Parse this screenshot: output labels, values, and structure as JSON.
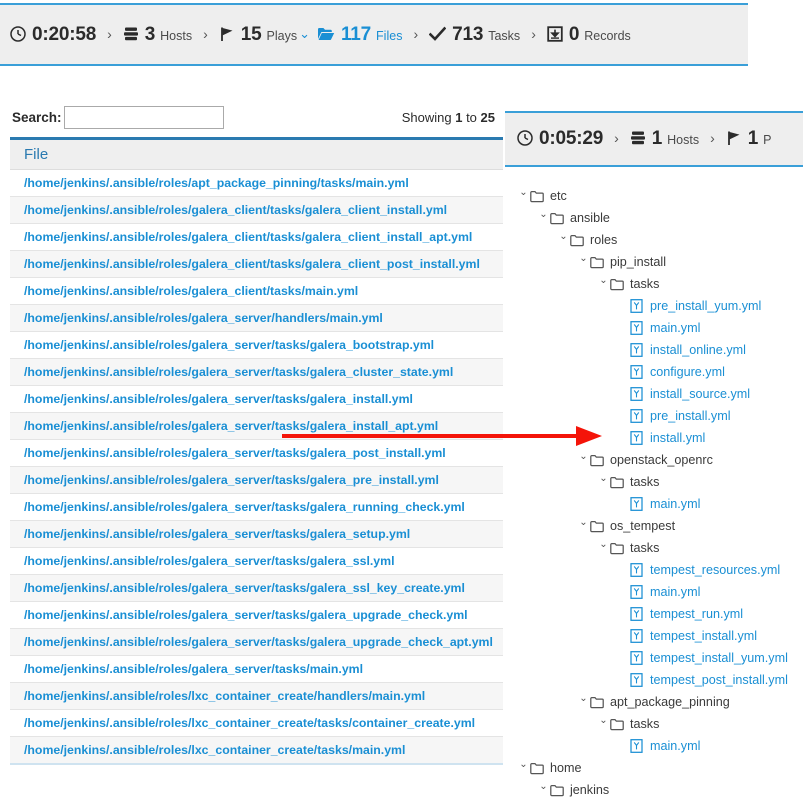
{
  "header": {
    "stats": [
      {
        "icon": "clock-icon",
        "value": "0:20:58",
        "label": "",
        "active": false,
        "type": "time"
      },
      {
        "icon": "server-stack-icon",
        "value": "3",
        "label": "Hosts",
        "active": false,
        "type": "stat"
      },
      {
        "icon": "flag-icon",
        "value": "15",
        "label": "Plays",
        "active": false,
        "type": "stat"
      },
      {
        "icon": "folder-open-icon",
        "value": "117",
        "label": "Files",
        "active": true,
        "type": "stat"
      },
      {
        "icon": "check-icon",
        "value": "713",
        "label": "Tasks",
        "active": false,
        "type": "stat"
      },
      {
        "icon": "download-box-icon",
        "value": "0",
        "label": "Records",
        "active": false,
        "type": "stat"
      }
    ],
    "separator": "›",
    "chevron_down": "⌄"
  },
  "subheader": {
    "stats": [
      {
        "icon": "clock-icon",
        "value": "0:05:29",
        "label": "",
        "active": false,
        "type": "time"
      },
      {
        "icon": "server-stack-icon",
        "value": "1",
        "label": "Hosts",
        "active": false,
        "type": "stat"
      },
      {
        "icon": "flag-icon",
        "value": "1",
        "label": "P",
        "active": false,
        "type": "stat"
      }
    ]
  },
  "files_panel": {
    "search_label": "Search:",
    "search_value": "",
    "search_placeholder": "",
    "showing_prefix": "Showing",
    "showing_from": "1",
    "showing_mid": "to",
    "showing_to": "25",
    "column_header": "File",
    "rows": [
      "/home/jenkins/.ansible/roles/apt_package_pinning/tasks/main.yml",
      "/home/jenkins/.ansible/roles/galera_client/tasks/galera_client_install.yml",
      "/home/jenkins/.ansible/roles/galera_client/tasks/galera_client_install_apt.yml",
      "/home/jenkins/.ansible/roles/galera_client/tasks/galera_client_post_install.yml",
      "/home/jenkins/.ansible/roles/galera_client/tasks/main.yml",
      "/home/jenkins/.ansible/roles/galera_server/handlers/main.yml",
      "/home/jenkins/.ansible/roles/galera_server/tasks/galera_bootstrap.yml",
      "/home/jenkins/.ansible/roles/galera_server/tasks/galera_cluster_state.yml",
      "/home/jenkins/.ansible/roles/galera_server/tasks/galera_install.yml",
      "/home/jenkins/.ansible/roles/galera_server/tasks/galera_install_apt.yml",
      "/home/jenkins/.ansible/roles/galera_server/tasks/galera_post_install.yml",
      "/home/jenkins/.ansible/roles/galera_server/tasks/galera_pre_install.yml",
      "/home/jenkins/.ansible/roles/galera_server/tasks/galera_running_check.yml",
      "/home/jenkins/.ansible/roles/galera_server/tasks/galera_setup.yml",
      "/home/jenkins/.ansible/roles/galera_server/tasks/galera_ssl.yml",
      "/home/jenkins/.ansible/roles/galera_server/tasks/galera_ssl_key_create.yml",
      "/home/jenkins/.ansible/roles/galera_server/tasks/galera_upgrade_check.yml",
      "/home/jenkins/.ansible/roles/galera_server/tasks/galera_upgrade_check_apt.yml",
      "/home/jenkins/.ansible/roles/galera_server/tasks/main.yml",
      "/home/jenkins/.ansible/roles/lxc_container_create/handlers/main.yml",
      "/home/jenkins/.ansible/roles/lxc_container_create/tasks/container_create.yml",
      "/home/jenkins/.ansible/roles/lxc_container_create/tasks/main.yml"
    ]
  },
  "tree_panel": {
    "nodes": [
      {
        "label": "etc",
        "depth": 0,
        "kind": "dir"
      },
      {
        "label": "ansible",
        "depth": 1,
        "kind": "dir"
      },
      {
        "label": "roles",
        "depth": 2,
        "kind": "dir"
      },
      {
        "label": "pip_install",
        "depth": 3,
        "kind": "dir"
      },
      {
        "label": "tasks",
        "depth": 4,
        "kind": "dir"
      },
      {
        "label": "pre_install_yum.yml",
        "depth": 5,
        "kind": "file"
      },
      {
        "label": "main.yml",
        "depth": 5,
        "kind": "file"
      },
      {
        "label": "install_online.yml",
        "depth": 5,
        "kind": "file"
      },
      {
        "label": "configure.yml",
        "depth": 5,
        "kind": "file"
      },
      {
        "label": "install_source.yml",
        "depth": 5,
        "kind": "file"
      },
      {
        "label": "pre_install.yml",
        "depth": 5,
        "kind": "file"
      },
      {
        "label": "install.yml",
        "depth": 5,
        "kind": "file"
      },
      {
        "label": "openstack_openrc",
        "depth": 3,
        "kind": "dir"
      },
      {
        "label": "tasks",
        "depth": 4,
        "kind": "dir"
      },
      {
        "label": "main.yml",
        "depth": 5,
        "kind": "file"
      },
      {
        "label": "os_tempest",
        "depth": 3,
        "kind": "dir"
      },
      {
        "label": "tasks",
        "depth": 4,
        "kind": "dir"
      },
      {
        "label": "tempest_resources.yml",
        "depth": 5,
        "kind": "file"
      },
      {
        "label": "main.yml",
        "depth": 5,
        "kind": "file"
      },
      {
        "label": "tempest_run.yml",
        "depth": 5,
        "kind": "file"
      },
      {
        "label": "tempest_install.yml",
        "depth": 5,
        "kind": "file"
      },
      {
        "label": "tempest_install_yum.yml",
        "depth": 5,
        "kind": "file"
      },
      {
        "label": "tempest_post_install.yml",
        "depth": 5,
        "kind": "file"
      },
      {
        "label": "apt_package_pinning",
        "depth": 3,
        "kind": "dir"
      },
      {
        "label": "tasks",
        "depth": 4,
        "kind": "dir"
      },
      {
        "label": "main.yml",
        "depth": 5,
        "kind": "file"
      },
      {
        "label": "home",
        "depth": 0,
        "kind": "dir"
      },
      {
        "label": "jenkins",
        "depth": 1,
        "kind": "dir"
      }
    ]
  },
  "annotation": {
    "arrow_color": "#f41409",
    "underline_color": "#f41409"
  },
  "colors": {
    "accent_blue": "#1a8fd4",
    "header_blue": "#2a7ab0",
    "bar_bg": "#eeeeee",
    "bar_border": "#3a9fd8"
  }
}
